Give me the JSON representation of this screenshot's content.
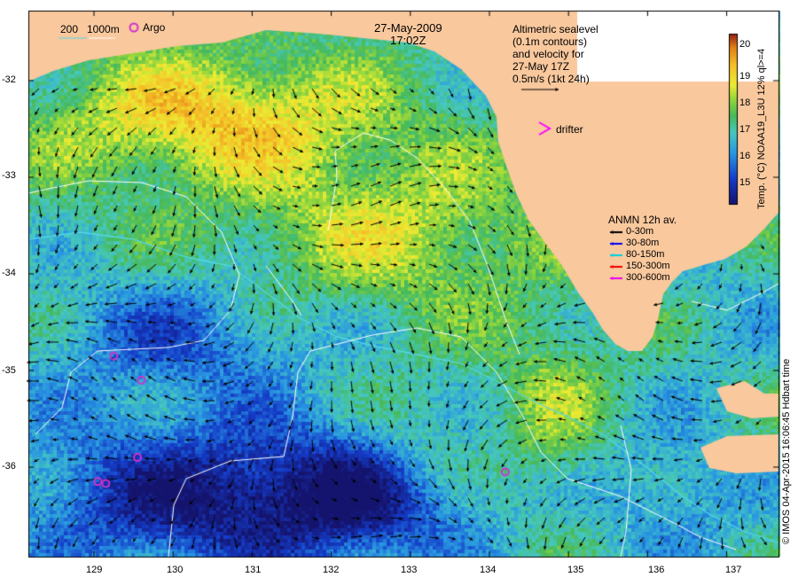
{
  "header": {
    "date": "27-May-2009",
    "time": "17:02Z"
  },
  "scale_legend": {
    "label_200": "200",
    "label_1000": "1000m"
  },
  "argo_label": "Argo",
  "drifter_label": "drifter",
  "altimetry_note": [
    "Altimetric sealevel",
    "(0.1m contours)",
    "and velocity for",
    "27-May 17Z",
    "0.5m/s (1kt 24h)"
  ],
  "anmn": {
    "title": "ANMN 12h av.",
    "items": [
      {
        "label": "0-30m",
        "color": "#000000"
      },
      {
        "label": "30-80m",
        "color": "#0000ee"
      },
      {
        "label": "80-150m",
        "color": "#00d0e0"
      },
      {
        "label": "150-300m",
        "color": "#ee0000"
      },
      {
        "label": "300-600m",
        "color": "#ee00ee"
      }
    ]
  },
  "colorbar": {
    "ticks": [
      "20",
      "19",
      "18",
      "17",
      "16",
      "15"
    ],
    "min": 14.5,
    "max": 20.5,
    "title": "Temp. (°C) NOAA19_L3U 12% ql>=4"
  },
  "credit": "© IMOS 04-Apr-2015 16:06:45 Hdbart time",
  "axes": {
    "lon_ticks": [
      "129",
      "130",
      "131",
      "132",
      "133",
      "134",
      "135",
      "136",
      "137"
    ],
    "lat_ticks": [
      "-32",
      "-33",
      "-34",
      "-35",
      "-36"
    ]
  },
  "argo_floats": [
    {
      "lon": 129.25,
      "lat": -34.85
    },
    {
      "lon": 129.6,
      "lat": -35.1
    },
    {
      "lon": 129.55,
      "lat": -35.9
    },
    {
      "lon": 129.05,
      "lat": -36.15
    },
    {
      "lon": 129.15,
      "lat": -36.17
    },
    {
      "lon": 134.2,
      "lat": -36.05
    }
  ],
  "colors": {
    "land": "#f9c89d",
    "argo": "#cc33cc",
    "drifter": "#ff00ff",
    "contour": "#ffffff",
    "shelf": "#55d6e6"
  }
}
